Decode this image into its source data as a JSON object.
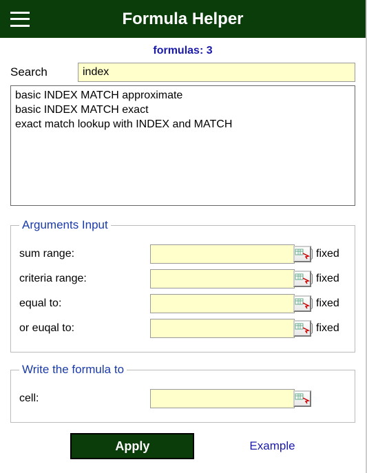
{
  "header": {
    "title": "Formula Helper"
  },
  "formulas_count_label": "formulas: 3",
  "search": {
    "label": "Search",
    "value": "index"
  },
  "results": [
    "basic INDEX MATCH approximate",
    "basic INDEX MATCH exact",
    "exact match lookup with INDEX and MATCH"
  ],
  "arguments": {
    "legend": "Arguments Input",
    "fields": [
      {
        "label": "sum range:",
        "value": "",
        "fixed_label": "fixed"
      },
      {
        "label": "criteria range:",
        "value": "",
        "fixed_label": "fixed"
      },
      {
        "label": "equal to:",
        "value": "",
        "fixed_label": "fixed"
      },
      {
        "label": "or euqal to:",
        "value": "",
        "fixed_label": "fixed"
      }
    ]
  },
  "target": {
    "legend": "Write the formula to",
    "label": "cell:",
    "value": ""
  },
  "buttons": {
    "apply": "Apply",
    "example": "Example"
  }
}
